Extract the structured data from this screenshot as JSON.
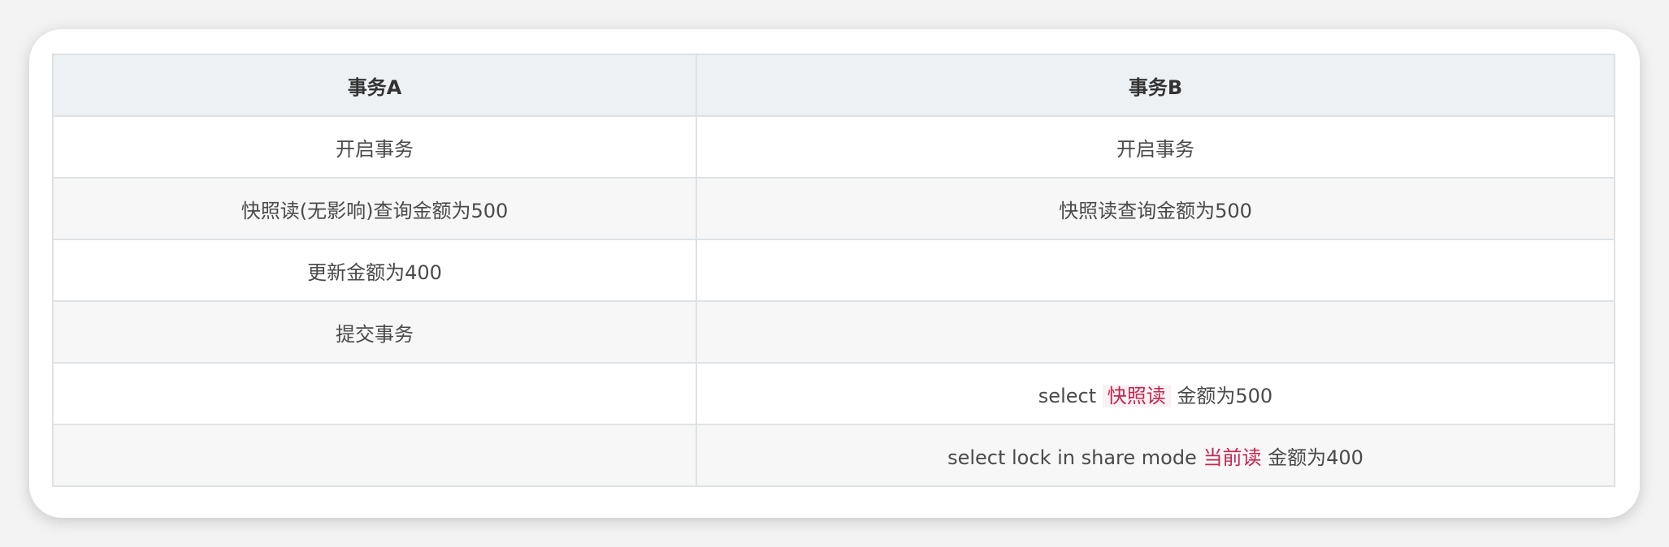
{
  "table": {
    "headers": [
      "事务A",
      "事务B"
    ],
    "rows": [
      {
        "a": "开启事务",
        "b": "开启事务"
      },
      {
        "a": "快照读(无影响)查询金额为500",
        "b": "快照读查询金额为500"
      },
      {
        "a": "更新金额为400",
        "b": ""
      },
      {
        "a": "提交事务",
        "b": ""
      },
      {
        "a": "",
        "b_parts": [
          "select",
          "快照读",
          "金额为500"
        ]
      },
      {
        "a": "",
        "b_parts": [
          "select lock in share mode",
          "当前读",
          "金额为400"
        ]
      }
    ]
  },
  "colors": {
    "highlight_text": "#c7254e",
    "highlight_bg": "#f9f2f4",
    "header_bg": "#eef1f4",
    "border": "#dfe2e5"
  }
}
